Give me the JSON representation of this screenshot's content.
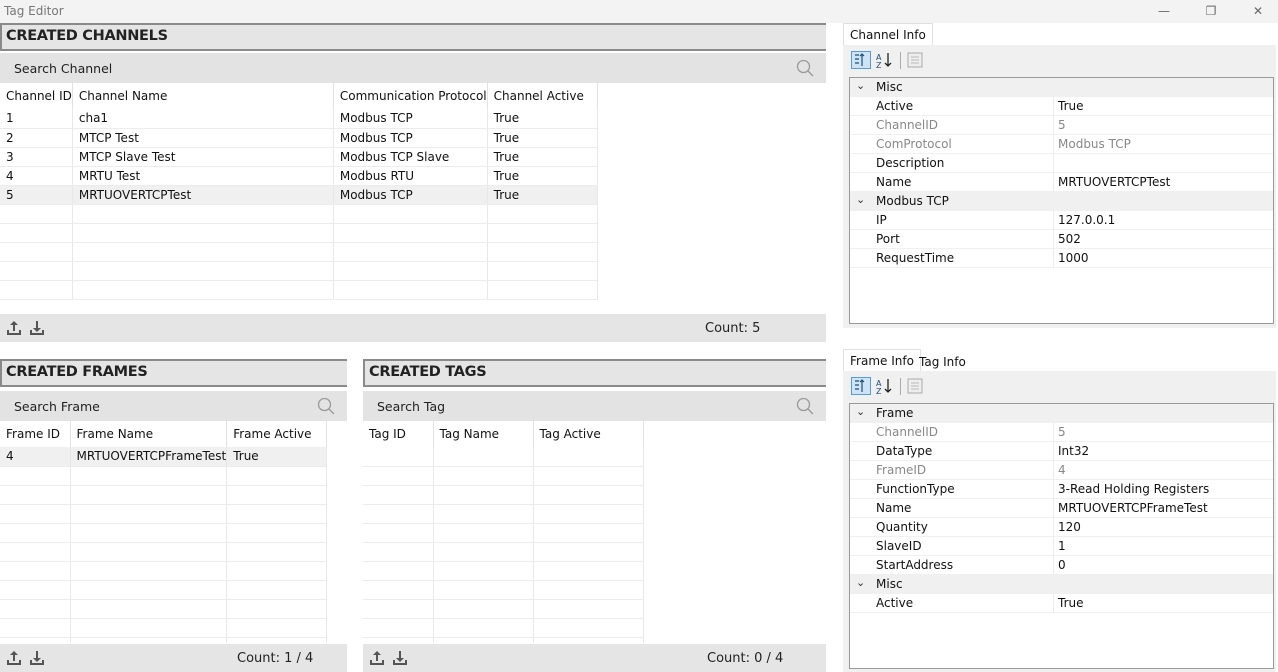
{
  "window": {
    "title": "Tag Editor",
    "min": "—",
    "restore": "❐",
    "close": "✕"
  },
  "channels": {
    "header": "CREATED CHANNELS",
    "search_placeholder": "Search Channel",
    "columns": [
      "Channel ID",
      "Channel Name",
      "Communication Protocol",
      "Channel Active"
    ],
    "rows": [
      [
        "1",
        "cha1",
        "Modbus TCP",
        "True"
      ],
      [
        "2",
        "MTCP Test",
        "Modbus TCP",
        "True"
      ],
      [
        "3",
        "MTCP Slave Test",
        "Modbus TCP Slave",
        "True"
      ],
      [
        "4",
        "MRTU Test",
        "Modbus RTU",
        "True"
      ],
      [
        "5",
        "MRTUOVERTCPTest",
        "Modbus TCP",
        "True"
      ]
    ],
    "count": "Count: 5"
  },
  "frames": {
    "header": "CREATED FRAMES",
    "search_placeholder": "Search Frame",
    "columns": [
      "Frame ID",
      "Frame Name",
      "Frame Active"
    ],
    "rows": [
      [
        "4",
        "MRTUOVERTCPFrameTest",
        "True"
      ]
    ],
    "count": "Count: 1 / 4"
  },
  "tags": {
    "header": "CREATED TAGS",
    "search_placeholder": "Search Tag",
    "columns": [
      "Tag ID",
      "Tag Name",
      "Tag Active"
    ],
    "rows": [],
    "count": "Count: 0 / 4"
  },
  "channel_info": {
    "tab": "Channel Info",
    "groups": [
      {
        "name": "Misc",
        "props": [
          {
            "k": "Active",
            "v": "True",
            "ro": false
          },
          {
            "k": "ChannelID",
            "v": "5",
            "ro": true
          },
          {
            "k": "ComProtocol",
            "v": "Modbus TCP",
            "ro": true
          },
          {
            "k": "Description",
            "v": "",
            "ro": false
          },
          {
            "k": "Name",
            "v": "MRTUOVERTCPTest",
            "ro": false
          }
        ]
      },
      {
        "name": "Modbus TCP",
        "props": [
          {
            "k": "IP",
            "v": "127.0.0.1",
            "ro": false
          },
          {
            "k": "Port",
            "v": "502",
            "ro": false
          },
          {
            "k": "RequestTime",
            "v": "1000",
            "ro": false
          }
        ]
      }
    ]
  },
  "frame_info": {
    "tabs": [
      "Frame Info",
      "Tag Info"
    ],
    "groups": [
      {
        "name": "Frame",
        "props": [
          {
            "k": "ChannelID",
            "v": "5",
            "ro": true
          },
          {
            "k": "DataType",
            "v": "Int32",
            "ro": false
          },
          {
            "k": "FrameID",
            "v": "4",
            "ro": true
          },
          {
            "k": "FunctionType",
            "v": "3-Read Holding Registers",
            "ro": false
          },
          {
            "k": "Name",
            "v": "MRTUOVERTCPFrameTest",
            "ro": false
          },
          {
            "k": "Quantity",
            "v": "120",
            "ro": false
          },
          {
            "k": "SlaveID",
            "v": "1",
            "ro": false
          },
          {
            "k": "StartAddress",
            "v": "0",
            "ro": false
          }
        ]
      },
      {
        "name": "Misc",
        "props": [
          {
            "k": "Active",
            "v": "True",
            "ro": false
          }
        ]
      }
    ]
  },
  "colors": {
    "header_bg": "#e5e5e5",
    "border": "#8a8a8a",
    "selected_row": "#f0f0f0"
  }
}
